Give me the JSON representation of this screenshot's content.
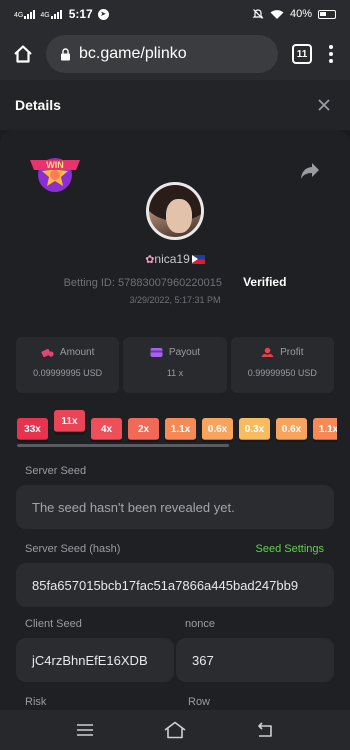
{
  "status_bar": {
    "network_1": "4G",
    "network_2": "4G",
    "time": "5:17",
    "battery": "40%",
    "icons": [
      "telegram-icon",
      "mute-icon",
      "wifi-icon",
      "battery-icon"
    ]
  },
  "browser": {
    "url": "bc.game/plinko",
    "tab_count": "11"
  },
  "header": {
    "title": "Details"
  },
  "bet": {
    "badge_text": "WIN",
    "username": "nica19",
    "betting_id_label": "Betting ID:",
    "betting_id": "57883007960220015",
    "verified_label": "Verified",
    "datetime": "3/29/2022, 5:17:31 PM"
  },
  "stats": [
    {
      "label": "Amount",
      "value": "0.09999995 USD",
      "icon": "coins-icon",
      "color": "#e2456f"
    },
    {
      "label": "Payout",
      "value": "11 x",
      "icon": "wallet-icon",
      "color": "#a95ff0"
    },
    {
      "label": "Profit",
      "value": "0.99999950 USD",
      "icon": "profit-icon",
      "color": "#e2454b"
    }
  ],
  "multipliers": [
    {
      "label": "33x",
      "color": "#e8334f",
      "raised": false
    },
    {
      "label": "11x",
      "color": "#e94557",
      "raised": true
    },
    {
      "label": "4x",
      "color": "#ee4f58",
      "raised": false
    },
    {
      "label": "2x",
      "color": "#f06a57",
      "raised": false
    },
    {
      "label": "1.1x",
      "color": "#f58a57",
      "raised": false
    },
    {
      "label": "0.6x",
      "color": "#f7a45c",
      "raised": false
    },
    {
      "label": "0.3x",
      "color": "#f8bb5e",
      "raised": false
    },
    {
      "label": "0.6x",
      "color": "#f7a45c",
      "raised": false
    },
    {
      "label": "1.1x",
      "color": "#f58a57",
      "raised": false
    }
  ],
  "fairness": {
    "server_seed_label": "Server Seed",
    "server_seed_value": "The seed hasn't been revealed yet.",
    "server_seed_hash_label": "Server Seed (hash)",
    "seed_settings_link": "Seed Settings",
    "server_seed_hash_value": "85fa657015bcb17fac51a7866a445bad247bb9",
    "client_seed_label": "Client Seed",
    "client_seed_value": "jC4rzBhnEfE16XDB",
    "nonce_label": "nonce",
    "nonce_value": "367",
    "risk_label": "Risk",
    "row_label": "Row"
  },
  "accent_colors": {
    "link": "#5ed34a",
    "panel": "#1f2023",
    "field": "#2b2c30"
  }
}
